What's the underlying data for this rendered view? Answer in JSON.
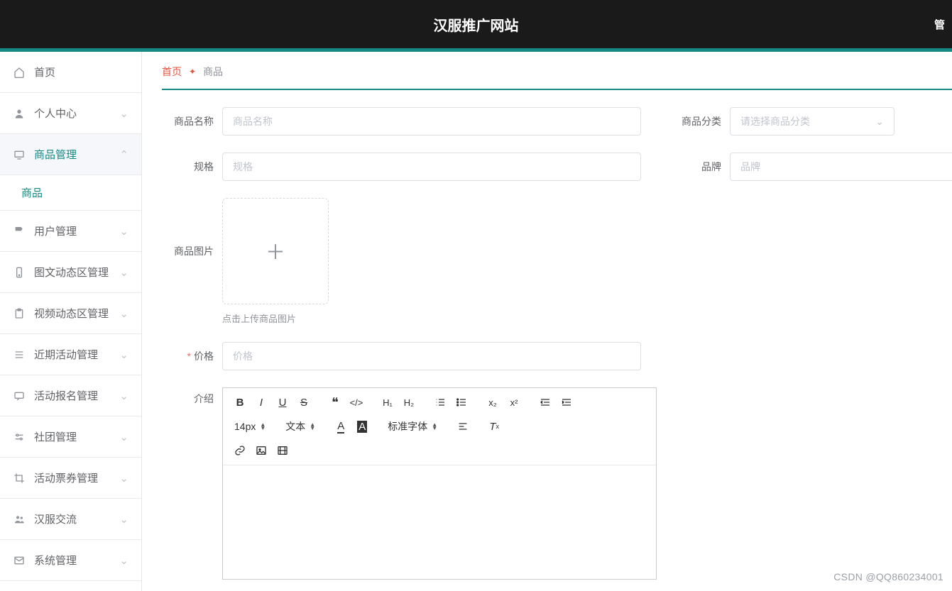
{
  "header": {
    "title": "汉服推广网站",
    "right": "管"
  },
  "sidebar": {
    "items": [
      {
        "icon": "home",
        "label": "首页"
      },
      {
        "icon": "person",
        "label": "个人中心"
      },
      {
        "icon": "tv",
        "label": "商品管理"
      },
      {
        "icon": "flag",
        "label": "用户管理"
      },
      {
        "icon": "phone",
        "label": "图文动态区管理"
      },
      {
        "icon": "clipboard",
        "label": "视频动态区管理"
      },
      {
        "icon": "lines",
        "label": "近期活动管理"
      },
      {
        "icon": "chat",
        "label": "活动报名管理"
      },
      {
        "icon": "sliders",
        "label": "社团管理"
      },
      {
        "icon": "crop",
        "label": "活动票券管理"
      },
      {
        "icon": "people",
        "label": "汉服交流"
      },
      {
        "icon": "mail",
        "label": "系统管理"
      }
    ],
    "sub": {
      "product": "商品"
    }
  },
  "breadcrumb": {
    "home": "首页",
    "current": "商品"
  },
  "form": {
    "name_label": "商品名称",
    "name_ph": "商品名称",
    "category_label": "商品分类",
    "category_ph": "请选择商品分类",
    "spec_label": "规格",
    "spec_ph": "规格",
    "brand_label": "品牌",
    "brand_ph": "品牌",
    "image_label": "商品图片",
    "image_hint": "点击上传商品图片",
    "price_label": "价格",
    "price_ph": "价格",
    "intro_label": "介绍"
  },
  "editor": {
    "fontsize": "14px",
    "format": "文本",
    "fontfamily": "标准字体"
  },
  "watermark": "CSDN @QQ860234001"
}
